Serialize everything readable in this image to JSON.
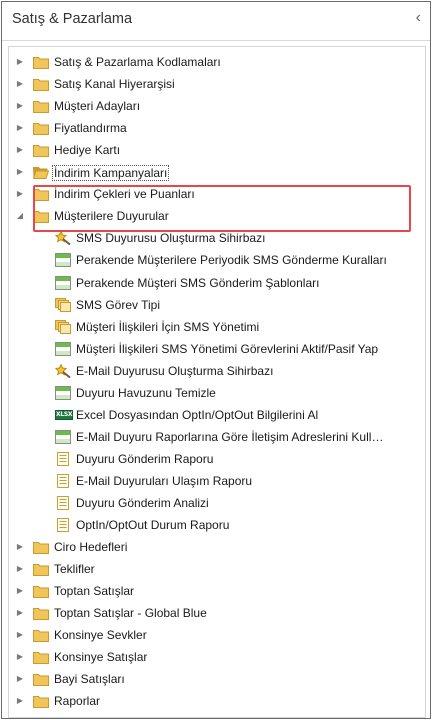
{
  "header": {
    "title": "Satış & Pazarlama",
    "collapse_glyph": "‹"
  },
  "colors": {
    "folder": "#f0c65a",
    "folder_dark": "#c99a2e",
    "green_icon": "#6dbb4a",
    "highlight": "#e5474b"
  },
  "tree": [
    {
      "label": "Satış & Pazarlama Kodlamaları",
      "level": 0,
      "icon": "folder-icon",
      "arrow": "right"
    },
    {
      "label": "Satış Kanal Hiyerarşisi",
      "level": 0,
      "icon": "folder-icon",
      "arrow": "right"
    },
    {
      "label": "Müşteri Adayları",
      "level": 0,
      "icon": "folder-icon",
      "arrow": "right"
    },
    {
      "label": "Fiyatlandırma",
      "level": 0,
      "icon": "folder-icon",
      "arrow": "right"
    },
    {
      "label": "Hediye Kartı",
      "level": 0,
      "icon": "folder-icon",
      "arrow": "right"
    },
    {
      "label": "İndirim Kampanyaları",
      "level": 0,
      "icon": "folder-open-icon",
      "arrow": "right",
      "focused": true
    },
    {
      "label": "İndirim Çekleri ve Puanları",
      "level": 0,
      "icon": "folder-icon",
      "arrow": "right"
    },
    {
      "label": "Müşterilere Duyurular",
      "level": 0,
      "icon": "folder-icon",
      "arrow": "down"
    },
    {
      "label": "SMS Duyurusu Oluşturma Sihirbazı",
      "level": 1,
      "icon": "wizard-icon"
    },
    {
      "label": "Perakende Müşterilere Periyodik SMS Gönderme Kuralları",
      "level": 1,
      "icon": "form-icon"
    },
    {
      "label": "Perakende Müşteri SMS Gönderim Şablonları",
      "level": 1,
      "icon": "form-icon"
    },
    {
      "label": "SMS Görev Tipi",
      "level": 1,
      "icon": "stack-icon"
    },
    {
      "label": "Müşteri İlişkileri İçin SMS Yönetimi",
      "level": 1,
      "icon": "stack-icon"
    },
    {
      "label": "Müşteri İlişkileri SMS Yönetimi Görevlerini Aktif/Pasif Yap",
      "level": 1,
      "icon": "form-icon"
    },
    {
      "label": "E-Mail Duyurusu Oluşturma Sihirbazı",
      "level": 1,
      "icon": "wizard-icon"
    },
    {
      "label": "Duyuru Havuzunu Temizle",
      "level": 1,
      "icon": "form-icon"
    },
    {
      "label": "Excel Dosyasından OptIn/OptOut Bilgilerini Al",
      "level": 1,
      "icon": "excel-icon",
      "badge": "XLSX"
    },
    {
      "label": "E-Mail Duyuru Raporlarına Göre İletişim Adreslerini Kull…",
      "level": 1,
      "icon": "form-icon"
    },
    {
      "label": "Duyuru Gönderim Raporu",
      "level": 1,
      "icon": "report-icon"
    },
    {
      "label": "E-Mail Duyuruları Ulaşım Raporu",
      "level": 1,
      "icon": "report-icon"
    },
    {
      "label": "Duyuru Gönderim Analizi",
      "level": 1,
      "icon": "report-icon"
    },
    {
      "label": "OptIn/OptOut Durum Raporu",
      "level": 1,
      "icon": "report-icon"
    },
    {
      "label": "Ciro Hedefleri",
      "level": 0,
      "icon": "folder-icon",
      "arrow": "right"
    },
    {
      "label": "Teklifler",
      "level": 0,
      "icon": "folder-icon",
      "arrow": "right"
    },
    {
      "label": "Toptan Satışlar",
      "level": 0,
      "icon": "folder-icon",
      "arrow": "right"
    },
    {
      "label": "Toptan Satışlar - Global Blue",
      "level": 0,
      "icon": "folder-icon",
      "arrow": "right"
    },
    {
      "label": "Konsinye Sevkler",
      "level": 0,
      "icon": "folder-icon",
      "arrow": "right"
    },
    {
      "label": "Konsinye Satışlar",
      "level": 0,
      "icon": "folder-icon",
      "arrow": "right"
    },
    {
      "label": "Bayi Satışları",
      "level": 0,
      "icon": "folder-icon",
      "arrow": "right"
    },
    {
      "label": "Raporlar",
      "level": 0,
      "icon": "folder-icon",
      "arrow": "right"
    }
  ]
}
